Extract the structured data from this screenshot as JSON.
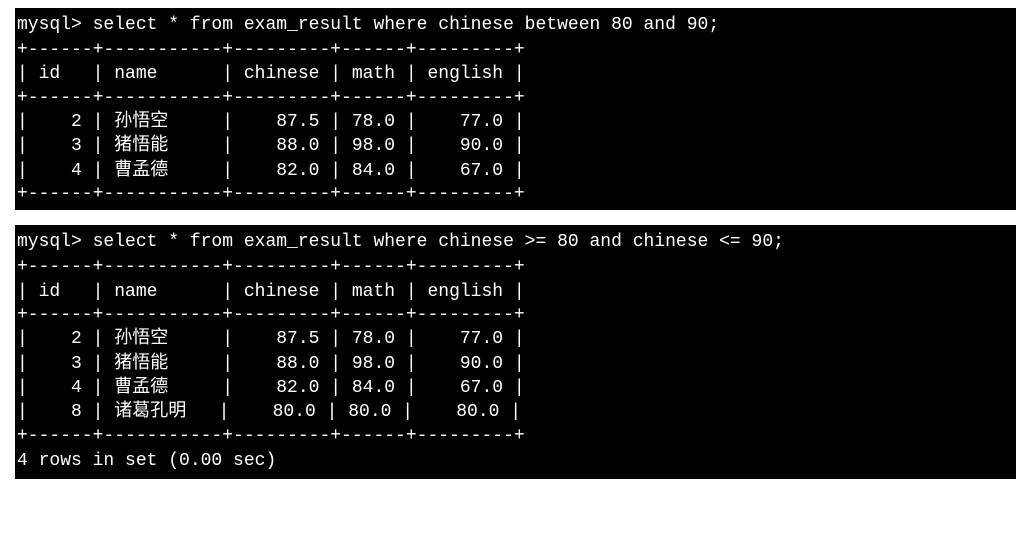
{
  "block1": {
    "prompt": "mysql> select * from exam_result where chinese between 80 and 90;",
    "sep": "+------+-----------+---------+------+---------+",
    "header": "| id   | name      | chinese | math | english |",
    "rows": [
      "|    2 | 孙悟空     |    87.5 | 78.0 |    77.0 |",
      "|    3 | 猪悟能     |    88.0 | 98.0 |    90.0 |",
      "|    4 | 曹孟德     |    82.0 | 84.0 |    67.0 |"
    ]
  },
  "block2": {
    "prompt": "mysql> select * from exam_result where chinese >= 80 and chinese <= 90;",
    "sep": "+------+-----------+---------+------+---------+",
    "header": "| id   | name      | chinese | math | english |",
    "rows": [
      "|    2 | 孙悟空     |    87.5 | 78.0 |    77.0 |",
      "|    3 | 猪悟能     |    88.0 | 98.0 |    90.0 |",
      "|    4 | 曹孟德     |    82.0 | 84.0 |    67.0 |",
      "|    8 | 诸葛孔明   |    80.0 | 80.0 |    80.0 |"
    ],
    "footer": "4 rows in set (0.00 sec)"
  },
  "chart_data": [
    {
      "type": "table",
      "title": "select * from exam_result where chinese between 80 and 90",
      "columns": [
        "id",
        "name",
        "chinese",
        "math",
        "english"
      ],
      "rows": [
        {
          "id": 2,
          "name": "孙悟空",
          "chinese": 87.5,
          "math": 78.0,
          "english": 77.0
        },
        {
          "id": 3,
          "name": "猪悟能",
          "chinese": 88.0,
          "math": 98.0,
          "english": 90.0
        },
        {
          "id": 4,
          "name": "曹孟德",
          "chinese": 82.0,
          "math": 84.0,
          "english": 67.0
        }
      ]
    },
    {
      "type": "table",
      "title": "select * from exam_result where chinese >= 80 and chinese <= 90",
      "columns": [
        "id",
        "name",
        "chinese",
        "math",
        "english"
      ],
      "rows": [
        {
          "id": 2,
          "name": "孙悟空",
          "chinese": 87.5,
          "math": 78.0,
          "english": 77.0
        },
        {
          "id": 3,
          "name": "猪悟能",
          "chinese": 88.0,
          "math": 98.0,
          "english": 90.0
        },
        {
          "id": 4,
          "name": "曹孟德",
          "chinese": 82.0,
          "math": 84.0,
          "english": 67.0
        },
        {
          "id": 8,
          "name": "诸葛孔明",
          "chinese": 80.0,
          "math": 80.0,
          "english": 80.0
        }
      ],
      "footer": "4 rows in set (0.00 sec)"
    }
  ]
}
